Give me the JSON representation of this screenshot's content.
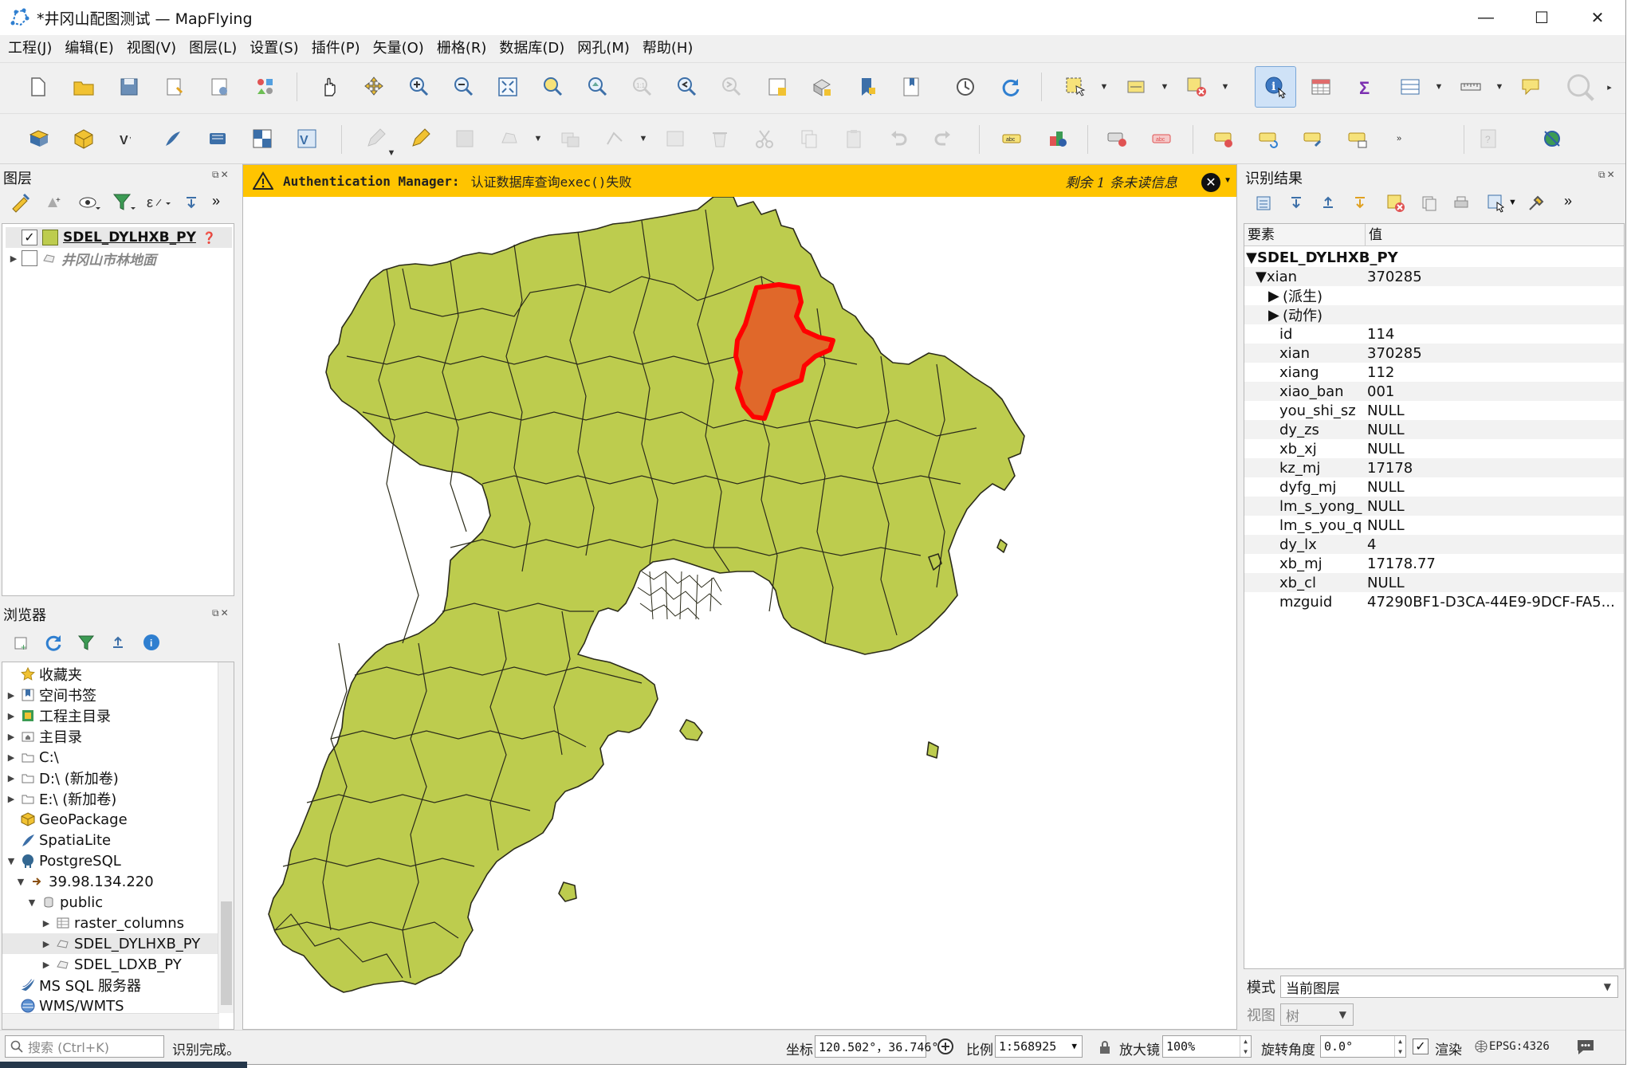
{
  "window": {
    "title": "*井冈山配图测试 — MapFlying",
    "minimize_glyph": "—",
    "maximize_glyph": "☐",
    "close_glyph": "✕"
  },
  "menu": [
    "工程(J)",
    "编辑(E)",
    "视图(V)",
    "图层(L)",
    "设置(S)",
    "插件(P)",
    "矢量(O)",
    "栅格(R)",
    "数据库(D)",
    "网孔(M)",
    "帮助(H)"
  ],
  "layers_panel": {
    "title": "图层",
    "layers": [
      {
        "name": "SDEL_DYLHXB_PY",
        "checked": "✓",
        "style": "bold",
        "color": "#bdcc4e"
      },
      {
        "name": "井冈山市林地面",
        "checked": "",
        "style": "italic-gray"
      }
    ]
  },
  "browser_panel": {
    "title": "浏览器",
    "items": [
      {
        "label": "收藏夹",
        "level": 0,
        "arrow": "",
        "icon": "star-icon"
      },
      {
        "label": "空间书签",
        "level": 0,
        "arrow": "▶",
        "icon": "bookmark-icon"
      },
      {
        "label": "工程主目录",
        "level": 0,
        "arrow": "▶",
        "icon": "project-home-icon"
      },
      {
        "label": "主目录",
        "level": 0,
        "arrow": "▶",
        "icon": "home-folder-icon"
      },
      {
        "label": "C:\\",
        "level": 0,
        "arrow": "▶",
        "icon": "folder-icon"
      },
      {
        "label": "D:\\ (新加卷)",
        "level": 0,
        "arrow": "▶",
        "icon": "folder-icon"
      },
      {
        "label": "E:\\ (新加卷)",
        "level": 0,
        "arrow": "▶",
        "icon": "folder-icon"
      },
      {
        "label": "GeoPackage",
        "level": 0,
        "arrow": "",
        "icon": "geopackage-icon"
      },
      {
        "label": "SpatiaLite",
        "level": 0,
        "arrow": "",
        "icon": "spatialite-icon"
      },
      {
        "label": "PostgreSQL",
        "level": 0,
        "arrow": "▼",
        "icon": "postgresql-icon"
      },
      {
        "label": "39.98.134.220",
        "level": 1,
        "arrow": "▼",
        "icon": "connection-icon"
      },
      {
        "label": "public",
        "level": 2,
        "arrow": "▼",
        "icon": "schema-icon"
      },
      {
        "label": "raster_columns",
        "level": 3,
        "arrow": "▶",
        "icon": "table-icon"
      },
      {
        "label": "SDEL_DYLHXB_PY",
        "level": 3,
        "arrow": "▶",
        "icon": "polygon-layer-icon",
        "selected": true
      },
      {
        "label": "SDEL_LDXB_PY",
        "level": 3,
        "arrow": "▶",
        "icon": "polygon-layer-icon"
      },
      {
        "label": "MS SQL 服务器",
        "level": 0,
        "arrow": "",
        "icon": "mssql-icon"
      },
      {
        "label": "WMS/WMTS",
        "level": 0,
        "arrow": "",
        "icon": "wms-icon"
      }
    ]
  },
  "message_bar": {
    "source": "Authentication Manager:",
    "text": "认证数据库查询exec()失败",
    "remaining": "剩余 1 条未读信息",
    "close_glyph": "✕"
  },
  "identify_panel": {
    "title": "识别结果",
    "col_feature": "要素",
    "col_value": "值",
    "layer_name": "SDEL_DYLHXB_PY",
    "feature_key": "xian",
    "feature_value": "370285",
    "groups": [
      "(派生)",
      "(动作)"
    ],
    "attributes": [
      {
        "key": "id",
        "value": "114"
      },
      {
        "key": "xian",
        "value": "370285"
      },
      {
        "key": "xiang",
        "value": "112"
      },
      {
        "key": "xiao_ban",
        "value": "001"
      },
      {
        "key": "you_shi_sz",
        "value": "NULL"
      },
      {
        "key": "dy_zs",
        "value": "NULL"
      },
      {
        "key": "xb_xj",
        "value": "NULL"
      },
      {
        "key": "kz_mj",
        "value": "17178"
      },
      {
        "key": "dyfg_mj",
        "value": "NULL"
      },
      {
        "key": "lm_s_yong_",
        "value": "NULL"
      },
      {
        "key": "lm_s_you_q",
        "value": "NULL"
      },
      {
        "key": "dy_lx",
        "value": "4"
      },
      {
        "key": "xb_mj",
        "value": "17178.77"
      },
      {
        "key": "xb_cl",
        "value": "NULL"
      },
      {
        "key": "mzguid",
        "value": "47290BF1-D3CA-44E9-9DCF-FA5..."
      }
    ],
    "mode_label": "模式",
    "mode_value": "当前图层",
    "view_label": "视图",
    "view_value": "树"
  },
  "status_bar": {
    "search_placeholder": "搜索 (Ctrl+K)",
    "status_message": "识别完成。",
    "coord_label": "坐标",
    "coord_value": "120.502°，36.746°",
    "scale_label": "比例",
    "scale_value": "1:568925",
    "magnifier_label": "放大镜",
    "magnifier_value": "100%",
    "rotation_label": "旋转角度",
    "rotation_value": "0.0°",
    "render_label": "渲染",
    "render_checked": "✓",
    "crs_value": "EPSG:4326"
  },
  "colors": {
    "polygon_fill": "#bdcc4e",
    "polygon_stroke": "#2b2b1a",
    "selected_fill": "#e0682a",
    "selected_stroke": "#ff0000",
    "message_bar": "#ffc400"
  }
}
